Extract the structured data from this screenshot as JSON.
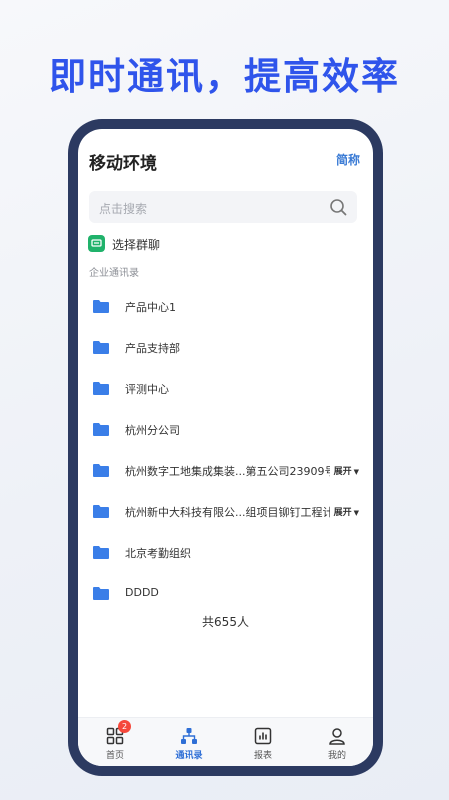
{
  "headline": "即时通讯，提高效率",
  "app": {
    "title": "移动环境",
    "mode_label": "简称"
  },
  "search": {
    "placeholder": "点击搜索"
  },
  "group_chat": {
    "label": "选择群聊",
    "icon": "group-chat-icon",
    "color": "#20b26b"
  },
  "section_label": "企业通讯录",
  "orgs": [
    {
      "name": "产品中心1"
    },
    {
      "name": "产品支持部"
    },
    {
      "name": "评测中心"
    },
    {
      "name": "杭州分公司"
    },
    {
      "name": "杭州数字工地集成集装...第五公司23909号",
      "expand": "展开"
    },
    {
      "name": "杭州新中大科技有限公...组项目铆钉工程计",
      "expand": "展开"
    },
    {
      "name": "北京考勤组织"
    },
    {
      "name": "DDDD"
    }
  ],
  "total": "共655人",
  "tabbar": {
    "tabs": [
      {
        "label": "首页",
        "icon": "grid-icon",
        "badge": "2"
      },
      {
        "label": "通讯录",
        "icon": "org-chart-icon",
        "active": true
      },
      {
        "label": "报表",
        "icon": "bar-chart-icon"
      },
      {
        "label": "我的",
        "icon": "person-icon"
      }
    ]
  },
  "colors": {
    "accent": "#2f54eb",
    "folder": "#3a7ee8",
    "badge": "#f5483b",
    "phone_frame": "#2c3a61"
  }
}
